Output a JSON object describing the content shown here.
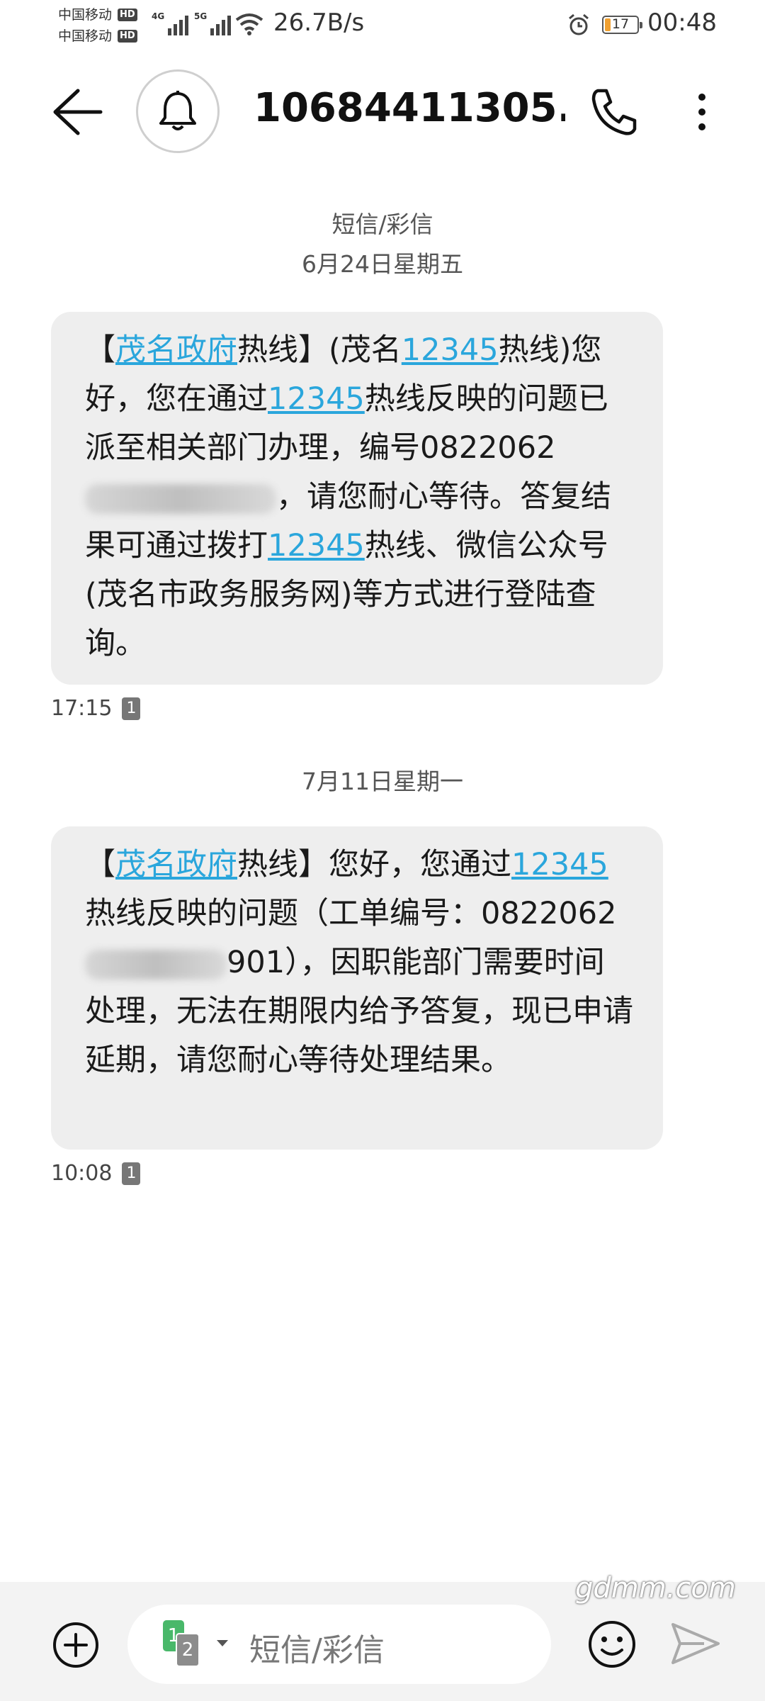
{
  "status_bar": {
    "carrier1": "中国移动",
    "carrier2": "中国移动",
    "hd_badge": "HD",
    "network1": "4G",
    "network2": "5G",
    "net_speed": "26.7B/s",
    "battery": "17",
    "time": "00:48"
  },
  "header": {
    "title": "10684411305...",
    "icons": [
      "back-arrow-icon",
      "bell-icon",
      "phone-icon",
      "more-vertical-icon"
    ]
  },
  "conversation": {
    "category_label": "短信/彩信",
    "date1": "6月24日星期五",
    "date2": "7月11日星期一",
    "msg1": {
      "t1": "【",
      "link1": "茂名政府",
      "t2": "热线】(茂名",
      "link2": "12345",
      "t3": "热线)您好，您在通过",
      "link3": "12345",
      "t4": "热线反映的问题已派至相关部门办理，编号0822062",
      "t5": "，请您耐心等待。答复结果可通过拨打",
      "link4": "12345",
      "t6": "热线、微信公众号(茂名市政务服务网)等方式进行登陆查询。",
      "time": "17:15",
      "sim": "1"
    },
    "msg2": {
      "t1": "【",
      "link1": "茂名政府",
      "t2": "热线】您好，您通过",
      "link2": "12345",
      "t3": "热线反映的问题（工单编号：0822062",
      "t4": "901），因职能部门需要时间处理，无法在期限内给予答复，现已申请延期，请您耐心等待处理结果。",
      "time": "10:08",
      "sim": "1"
    }
  },
  "input_bar": {
    "placeholder": "短信/彩信",
    "sim1": "1",
    "sim2": "2"
  },
  "watermark": "gdmm.com",
  "colors": {
    "link": "#2aa6dc",
    "bubble": "#eeeeee",
    "sim_green": "#49b86a"
  }
}
